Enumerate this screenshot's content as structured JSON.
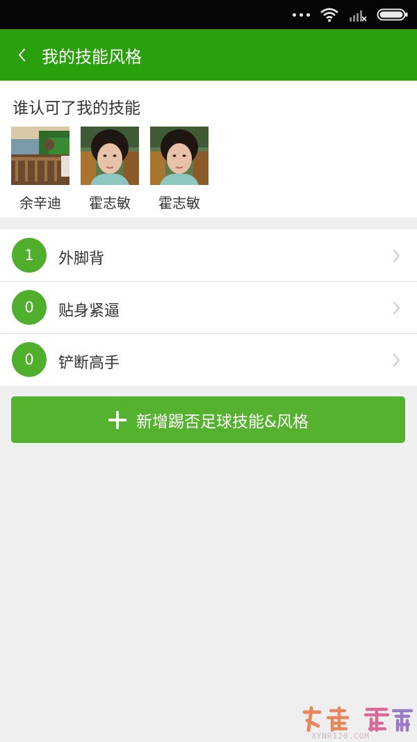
{
  "header": {
    "title": "我的技能风格"
  },
  "endorsements": {
    "title": "谁认可了我的技能",
    "users": [
      {
        "name": "余辛迪"
      },
      {
        "name": "霍志敏"
      },
      {
        "name": "霍志敏"
      }
    ]
  },
  "skills": [
    {
      "count": "1",
      "name": "外脚背"
    },
    {
      "count": "0",
      "name": "贴身紧逼"
    },
    {
      "count": "0",
      "name": "铲断高手"
    }
  ],
  "add_button": {
    "label": "新增踢否足球技能&风格"
  },
  "watermark": {
    "text": "XYNR120.COM"
  },
  "colors": {
    "header_green": "#2aa10c",
    "button_green": "#55b22f",
    "badge_green": "#4fae2c",
    "background": "#efefef"
  }
}
